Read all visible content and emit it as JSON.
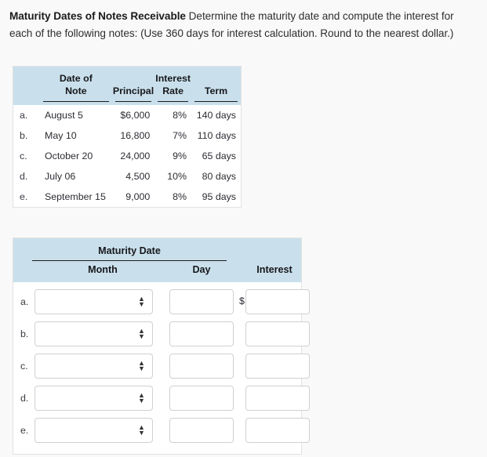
{
  "prompt": {
    "lead": "Maturity Dates of Notes Receivable",
    "body": " Determine the maturity date and compute the interest for each of the following notes: (Use 360 days for interest calculation. Round to the nearest dollar.)"
  },
  "notes_table": {
    "headers": {
      "index": "",
      "date_line1": "Date of",
      "date_line2": "Note",
      "principal_line1": "",
      "principal_line2": "Principal",
      "rate_line1": "Interest",
      "rate_line2": "Rate",
      "term_line1": "",
      "term_line2": "Term"
    },
    "rows": [
      {
        "index": "a.",
        "date": "August 5",
        "principal": "$6,000",
        "rate": "8%",
        "term": "140 days"
      },
      {
        "index": "b.",
        "date": "May 10",
        "principal": "16,800",
        "rate": "7%",
        "term": "110 days"
      },
      {
        "index": "c.",
        "date": "October 20",
        "principal": "24,000",
        "rate": "9%",
        "term": "65 days"
      },
      {
        "index": "d.",
        "date": "July 06",
        "principal": "4,500",
        "rate": "10%",
        "term": "80 days"
      },
      {
        "index": "e.",
        "date": "September 15",
        "principal": "9,000",
        "rate": "8%",
        "term": "95 days"
      }
    ]
  },
  "answer_table": {
    "group_header": "Maturity Date",
    "headers": {
      "month": "Month",
      "day": "Day",
      "interest": "Interest"
    },
    "currency_symbol": "$",
    "spinner_up": "▲",
    "spinner_down": "▼",
    "rows": [
      {
        "index": "a.",
        "month_value": "",
        "day_value": "",
        "interest_value": "",
        "show_currency": true
      },
      {
        "index": "b.",
        "month_value": "",
        "day_value": "",
        "interest_value": "",
        "show_currency": false
      },
      {
        "index": "c.",
        "month_value": "",
        "day_value": "",
        "interest_value": "",
        "show_currency": false
      },
      {
        "index": "d.",
        "month_value": "",
        "day_value": "",
        "interest_value": "",
        "show_currency": false
      },
      {
        "index": "e.",
        "month_value": "",
        "day_value": "",
        "interest_value": "",
        "show_currency": false
      }
    ]
  },
  "colors": {
    "header_band": "#c9e0ec",
    "page_background": "#f9f9f9",
    "table_border": "#e2e2e2",
    "input_border": "#d0d0d0"
  }
}
